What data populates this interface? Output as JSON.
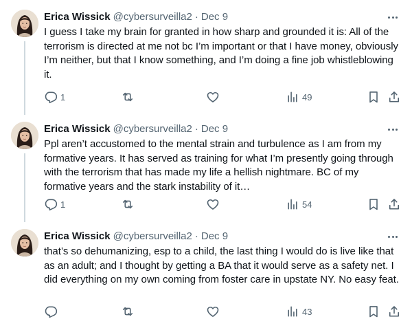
{
  "tweets": [
    {
      "author_name": "Erica Wissick",
      "handle": "@cybersurveilla2",
      "separator": "·",
      "date": "Dec 9",
      "text": "I guess I take my brain for granted in how sharp and grounded it is: All of the terrorism is directed at me not bc I’m important or that I have money, obviously I’m neither, but that I know something, and I’m doing a fine job whistleblowing it.",
      "reply_count": "1",
      "retweet_count": "",
      "like_count": "",
      "view_count": "49"
    },
    {
      "author_name": "Erica Wissick",
      "handle": "@cybersurveilla2",
      "separator": "·",
      "date": "Dec 9",
      "text": "Ppl aren’t accustomed to the mental strain and turbulence as I am from my formative years. It has served as training for what I’m presently going through with the terrorism that has made my life a hellish nightmare. BC of my formative years and the stark instability of it…",
      "reply_count": "1",
      "retweet_count": "",
      "like_count": "",
      "view_count": "54"
    },
    {
      "author_name": "Erica Wissick",
      "handle": "@cybersurveilla2",
      "separator": "·",
      "date": "Dec 9",
      "text": "that’s so dehumanizing, esp to a child, the last thing I would do is live like that as an adult; and I thought by getting a BA that it would serve as a safety net. I did everything on my own coming from foster care in upstate NY. No easy feat.",
      "reply_count": "",
      "retweet_count": "",
      "like_count": "",
      "view_count": "43"
    }
  ],
  "icons": {
    "reply": "reply-icon",
    "retweet": "retweet-icon",
    "like": "heart-icon",
    "views": "views-icon",
    "bookmark": "bookmark-icon",
    "share": "share-icon",
    "more": "more-icon"
  },
  "colors": {
    "text": "#0f1419",
    "secondary": "#536471",
    "thread_line": "#cfd9de",
    "background": "#ffffff"
  }
}
